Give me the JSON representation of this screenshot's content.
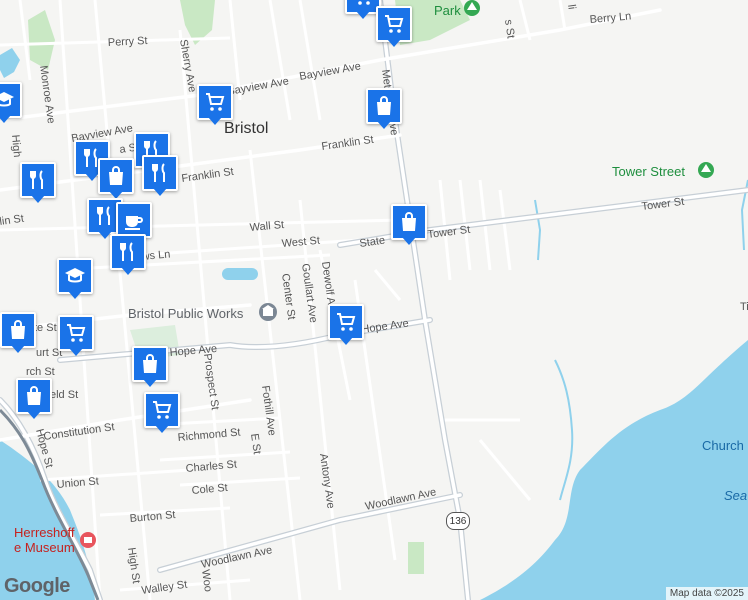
{
  "map": {
    "labels": {
      "town": "Bristol",
      "public_works": "Bristol Public Works",
      "tower_street_park": "Tower Street",
      "park_top": "Park",
      "museum_line1": "Herreshoff",
      "museum_line2": "e Museum",
      "church": "Church C",
      "sea": "Sea"
    },
    "roads": {
      "perry": "Perry St",
      "berry": "Berry Ln",
      "bayview1": "Bayview Ave",
      "bayview2": "Bayview Ave",
      "bayview3": "Bayview Ave",
      "franklin1": "Franklin St",
      "franklin2": "Franklin St",
      "wall": "Wall St",
      "west": "West St",
      "state": "State",
      "tower1": "Tower St",
      "tower2": "Tower St",
      "hope_ave1": "Hope Ave",
      "hope_ave2": "Hope Ave",
      "constitution": "Constitution St",
      "richmond": "Richmond St",
      "charles": "Charles St",
      "cole": "Cole St",
      "union": "Union St",
      "burton": "Burton St",
      "woodlawn1": "Woodlawn Ave",
      "woodlawn2": "Woodlawn Ave",
      "walley": "Walley St",
      "monroe": "Monroe Ave",
      "sherry": "Sherry Ave",
      "metacom": "Metacom Ave",
      "high1": "High",
      "high2": "High St",
      "center": "Center St",
      "goullart": "Goullart Ave",
      "dewolf": "Dewolf A",
      "prospect": "Prospect St",
      "fothill": "Fothill Ave",
      "e_st": "E St",
      "antony": "Antony Ave",
      "hope_st": "Hope St",
      "woo": "Woo",
      "lin_st": "lin St",
      "te_st": "te St",
      "rch_st": "rch St",
      "urt_st": "urt St",
      "eld_st": "eld St",
      "ws_ln": "ws Ln",
      "a_st": "a St",
      "s_st": "s St",
      "li": "li",
      "ti": "Ti"
    },
    "route_shield": "136",
    "logo": "Google",
    "attribution": "Map data ©2025"
  },
  "markers": [
    {
      "type": "grocery",
      "icon": "shopping-cart-icon"
    },
    {
      "type": "grocery",
      "icon": "shopping-cart-icon"
    },
    {
      "type": "grocery",
      "icon": "shopping-cart-icon"
    },
    {
      "type": "shopping",
      "icon": "shopping-bag-icon"
    },
    {
      "type": "shopping",
      "icon": "shopping-bag-icon"
    },
    {
      "type": "grocery",
      "icon": "shopping-cart-icon"
    },
    {
      "type": "restaurant",
      "icon": "fork-knife-icon"
    },
    {
      "type": "restaurant",
      "icon": "fork-knife-icon"
    },
    {
      "type": "restaurant",
      "icon": "fork-knife-icon"
    },
    {
      "type": "shopping",
      "icon": "shopping-bag-icon"
    },
    {
      "type": "restaurant",
      "icon": "fork-knife-icon"
    },
    {
      "type": "restaurant",
      "icon": "fork-knife-icon"
    },
    {
      "type": "cafe",
      "icon": "coffee-cup-icon"
    },
    {
      "type": "restaurant",
      "icon": "fork-knife-icon"
    },
    {
      "type": "school",
      "icon": "graduation-cap-icon"
    },
    {
      "type": "grocery",
      "icon": "shopping-cart-icon"
    },
    {
      "type": "shopping",
      "icon": "shopping-bag-icon"
    },
    {
      "type": "shopping",
      "icon": "shopping-bag-icon"
    },
    {
      "type": "grocery",
      "icon": "shopping-cart-icon"
    },
    {
      "type": "shopping",
      "icon": "shopping-bag-icon"
    },
    {
      "type": "school",
      "icon": "graduation-cap-icon"
    }
  ],
  "colors": {
    "land": "#f5f5f3",
    "water": "#8fd1ec",
    "park": "#c9e8c4",
    "road": "#ffffff",
    "major_road": "#c7cfd6",
    "marker": "#1a73e8"
  }
}
